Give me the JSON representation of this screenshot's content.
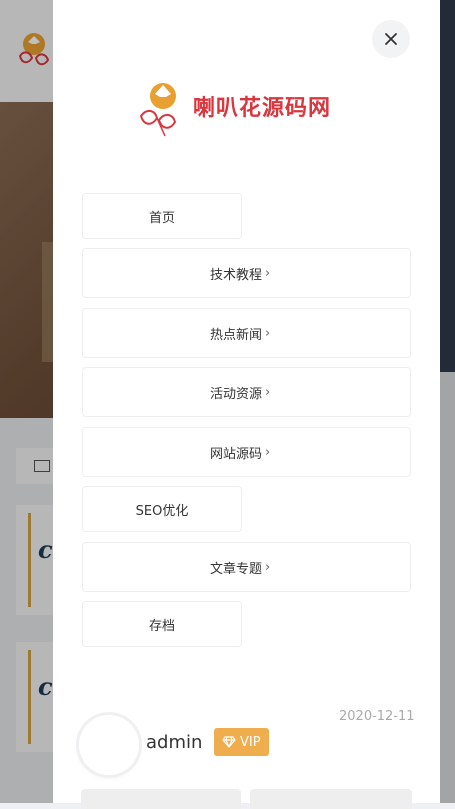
{
  "brand": {
    "logo_text": "喇叭花",
    "logo_subtext": "源码网"
  },
  "drawer": {
    "close_icon": "close-icon",
    "nav": [
      {
        "label": "首页",
        "has_submenu": false
      },
      {
        "label": "技术教程",
        "has_submenu": true
      },
      {
        "label": "热点新闻",
        "has_submenu": true
      },
      {
        "label": "活动资源",
        "has_submenu": true
      },
      {
        "label": "网站源码",
        "has_submenu": true
      },
      {
        "label": "SEO优化",
        "has_submenu": false
      },
      {
        "label": "文章专题",
        "has_submenu": true
      },
      {
        "label": "存档",
        "has_submenu": false
      }
    ],
    "chevron": "›",
    "date": "2020-12-11",
    "user": {
      "name": "admin",
      "badge": "VIP",
      "badge_icon": "diamond-icon"
    }
  },
  "colors": {
    "accent": "#f0ad4e",
    "text": "#333333",
    "muted": "#aaaaaa",
    "logo_orange": "#e8a030",
    "logo_red": "#d9363e"
  }
}
